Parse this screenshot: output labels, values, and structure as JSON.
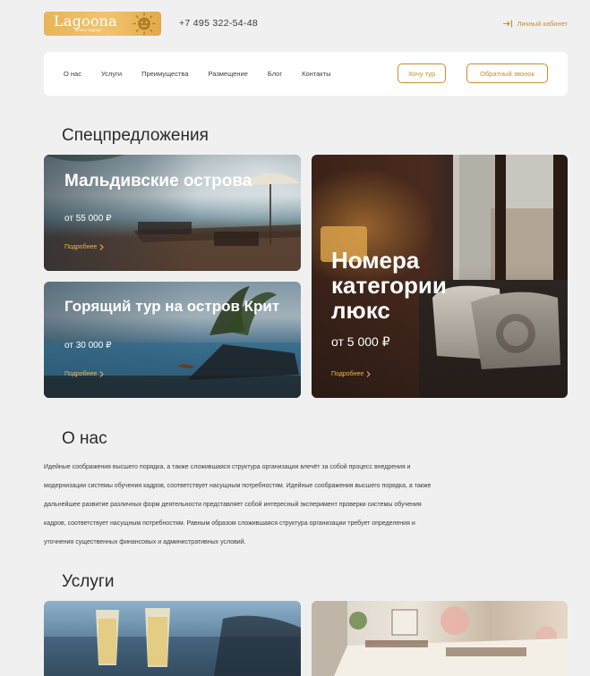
{
  "header": {
    "logo_word": "Lagoona",
    "logo_tagline": "отель-курорт",
    "phone": "+7 495 322-54-48",
    "cabinet_label": "Личный кабинет"
  },
  "nav": {
    "items": [
      "О нас",
      "Услуги",
      "Преимущества",
      "Размещение",
      "Блог",
      "Контакты"
    ],
    "tour_button": "Хочу тур",
    "call_button": "Обратный звонок"
  },
  "specials": {
    "title": "Спецпредложения",
    "more_label": "Подробнее",
    "cards": [
      {
        "title": "Мальдивские острова",
        "price": "от 55 000 ₽"
      },
      {
        "title": "Горящий тур на остров Крит",
        "price": "от 30 000 ₽"
      },
      {
        "title": "Номера категории люкс",
        "price": "от 5 000 ₽"
      }
    ]
  },
  "about": {
    "title": "О нас",
    "text": "Идейные соображения высшего порядка, а также сложившаяся структура организации влечёт за собой процесс внедрения и модернизации системы обучения кадров, соответствует насущным потребностям. Идейные соображения высшего порядка, а также дальнейшее развитие различных форм деятельности представляет собой интересный эксперимент проверки системы обучения кадров, соответствует насущным потребностям. Равным образом сложившаяся структура организации требует определения и уточнения существенных финансовых и административных условий."
  },
  "services": {
    "title": "Услуги"
  },
  "colors": {
    "accent": "#c68e2e",
    "more_link": "#f0b454",
    "background": "#f0f0f0",
    "logo": "#eab85c"
  }
}
